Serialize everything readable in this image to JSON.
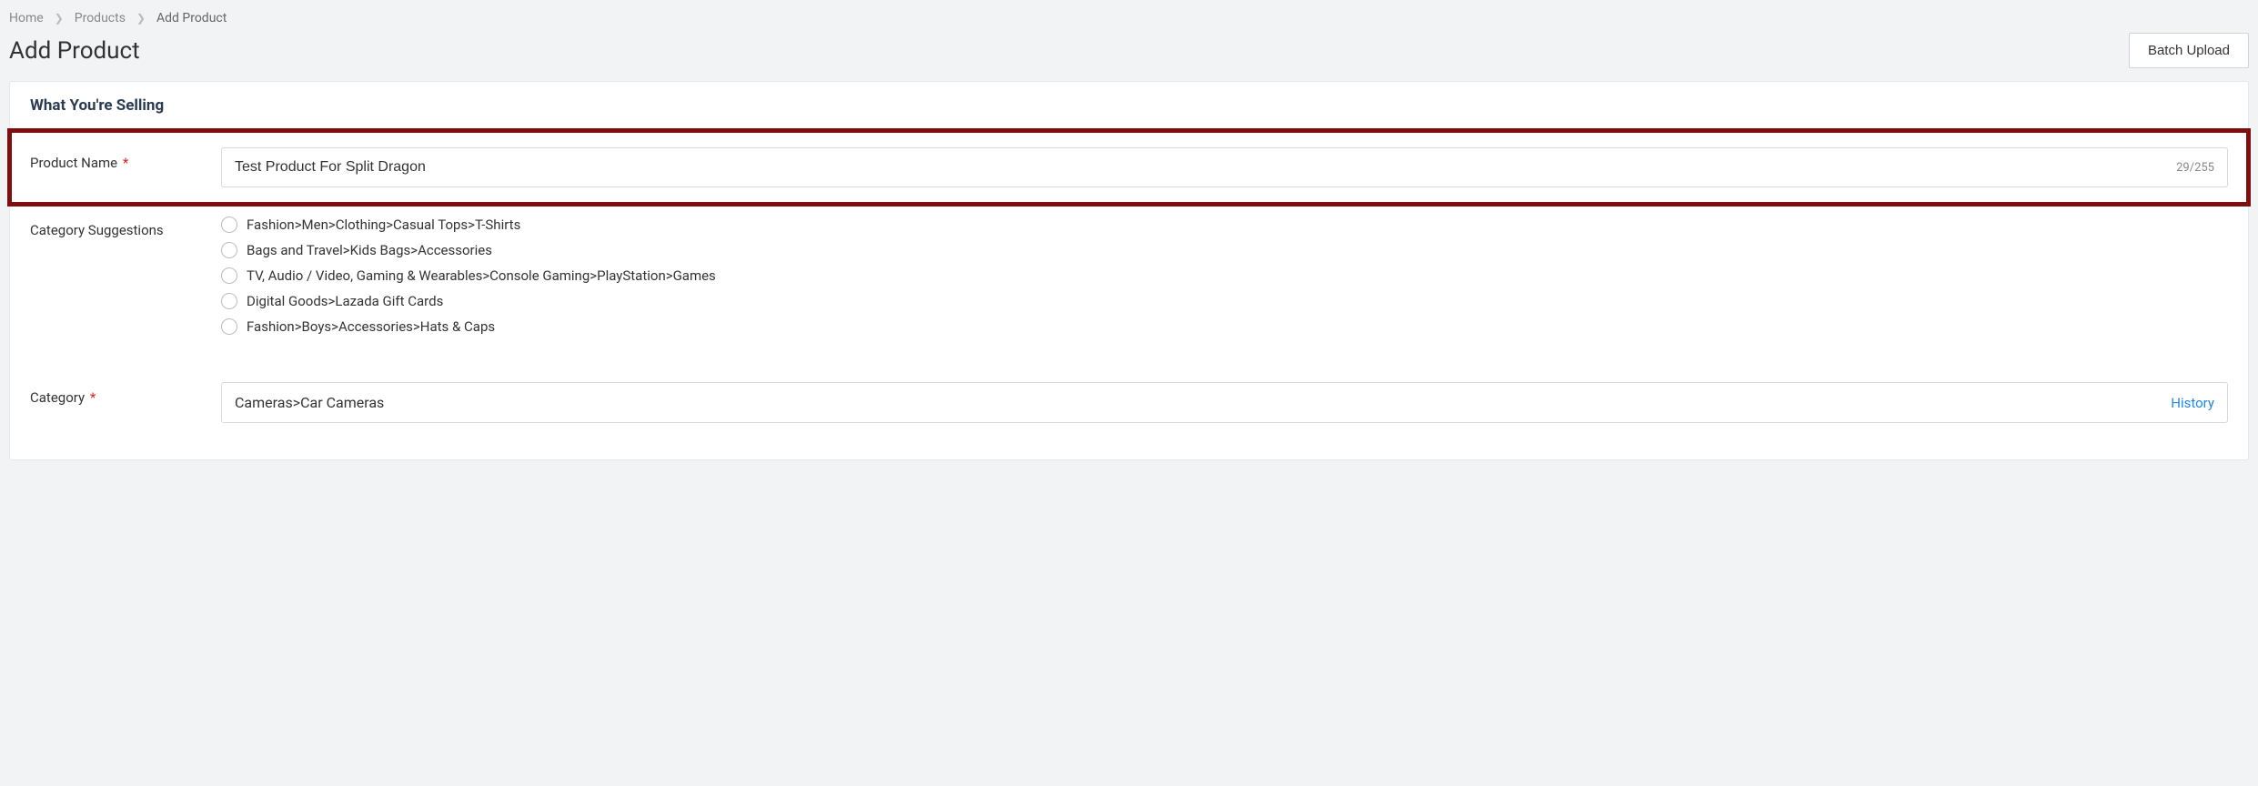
{
  "breadcrumb": {
    "home": "Home",
    "products": "Products",
    "add_product": "Add Product"
  },
  "page_title": "Add Product",
  "batch_upload_label": "Batch Upload",
  "section_title": "What You're Selling",
  "product_name": {
    "label": "Product Name",
    "value": "Test Product For Split Dragon",
    "counter": "29/255"
  },
  "category_suggestions": {
    "label": "Category Suggestions",
    "options": [
      "Fashion>Men>Clothing>Casual Tops>T-Shirts",
      "Bags and Travel>Kids Bags>Accessories",
      "TV, Audio / Video, Gaming & Wearables>Console Gaming>PlayStation>Games",
      "Digital Goods>Lazada Gift Cards",
      "Fashion>Boys>Accessories>Hats & Caps"
    ]
  },
  "category": {
    "label": "Category",
    "value": "Cameras>Car Cameras",
    "history_label": "History"
  },
  "required_marker": "*"
}
